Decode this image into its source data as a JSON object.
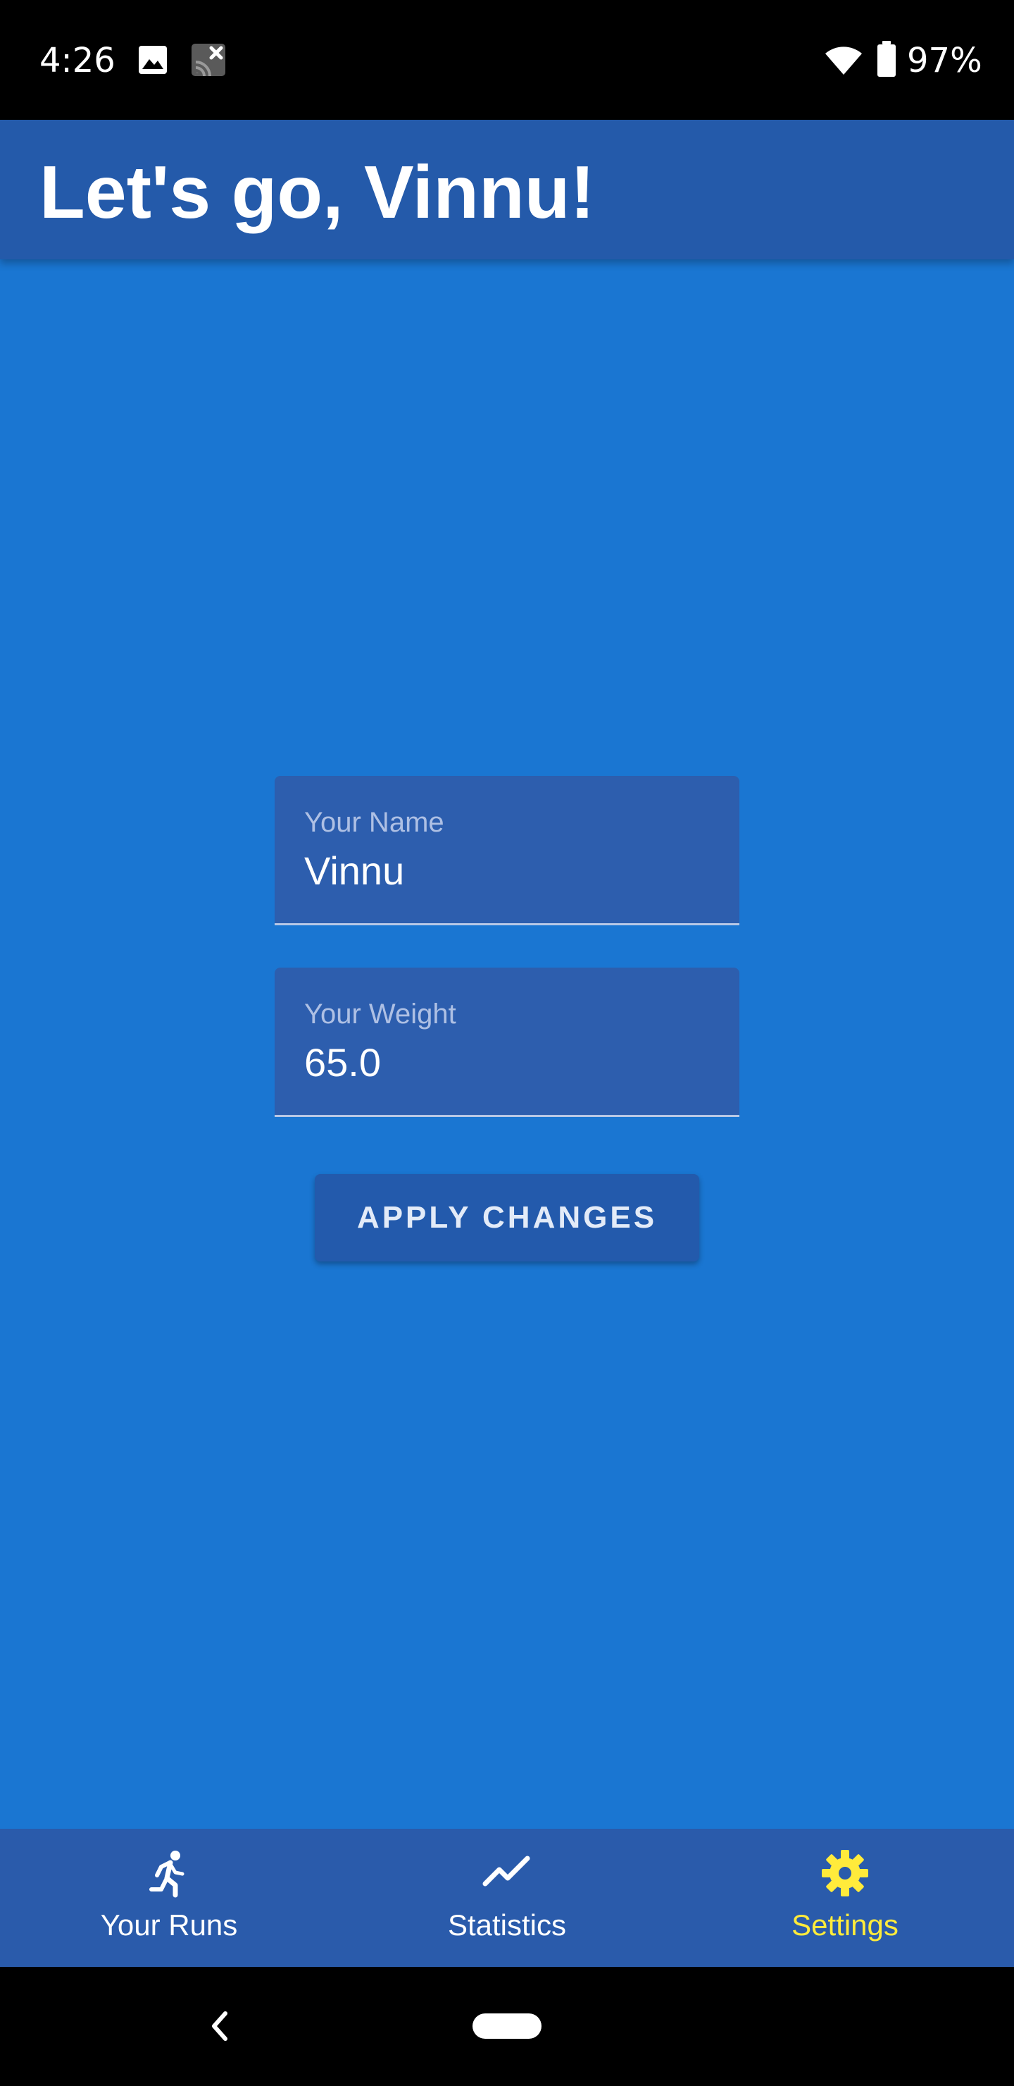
{
  "status_bar": {
    "time": "4:26",
    "battery": "97%",
    "icons": [
      "image-icon",
      "cast-off-icon",
      "wifi-icon",
      "battery-icon"
    ]
  },
  "app_bar": {
    "title": "Let's go, Vinnu!"
  },
  "form": {
    "name_label": "Your Name",
    "name_value": "Vinnu",
    "weight_label": "Your Weight",
    "weight_value": "65.0",
    "apply_label": "APPLY CHANGES"
  },
  "bottom_nav": {
    "items": [
      {
        "label": "Your Runs",
        "icon": "running-icon",
        "active": false
      },
      {
        "label": "Statistics",
        "icon": "trending-line-icon",
        "active": false
      },
      {
        "label": "Settings",
        "icon": "gear-icon",
        "active": true
      }
    ]
  },
  "colors": {
    "background": "#1a76d2",
    "app_bar": "#245aaa",
    "field": "#2d5eae",
    "active_nav": "#ffeb3b"
  }
}
